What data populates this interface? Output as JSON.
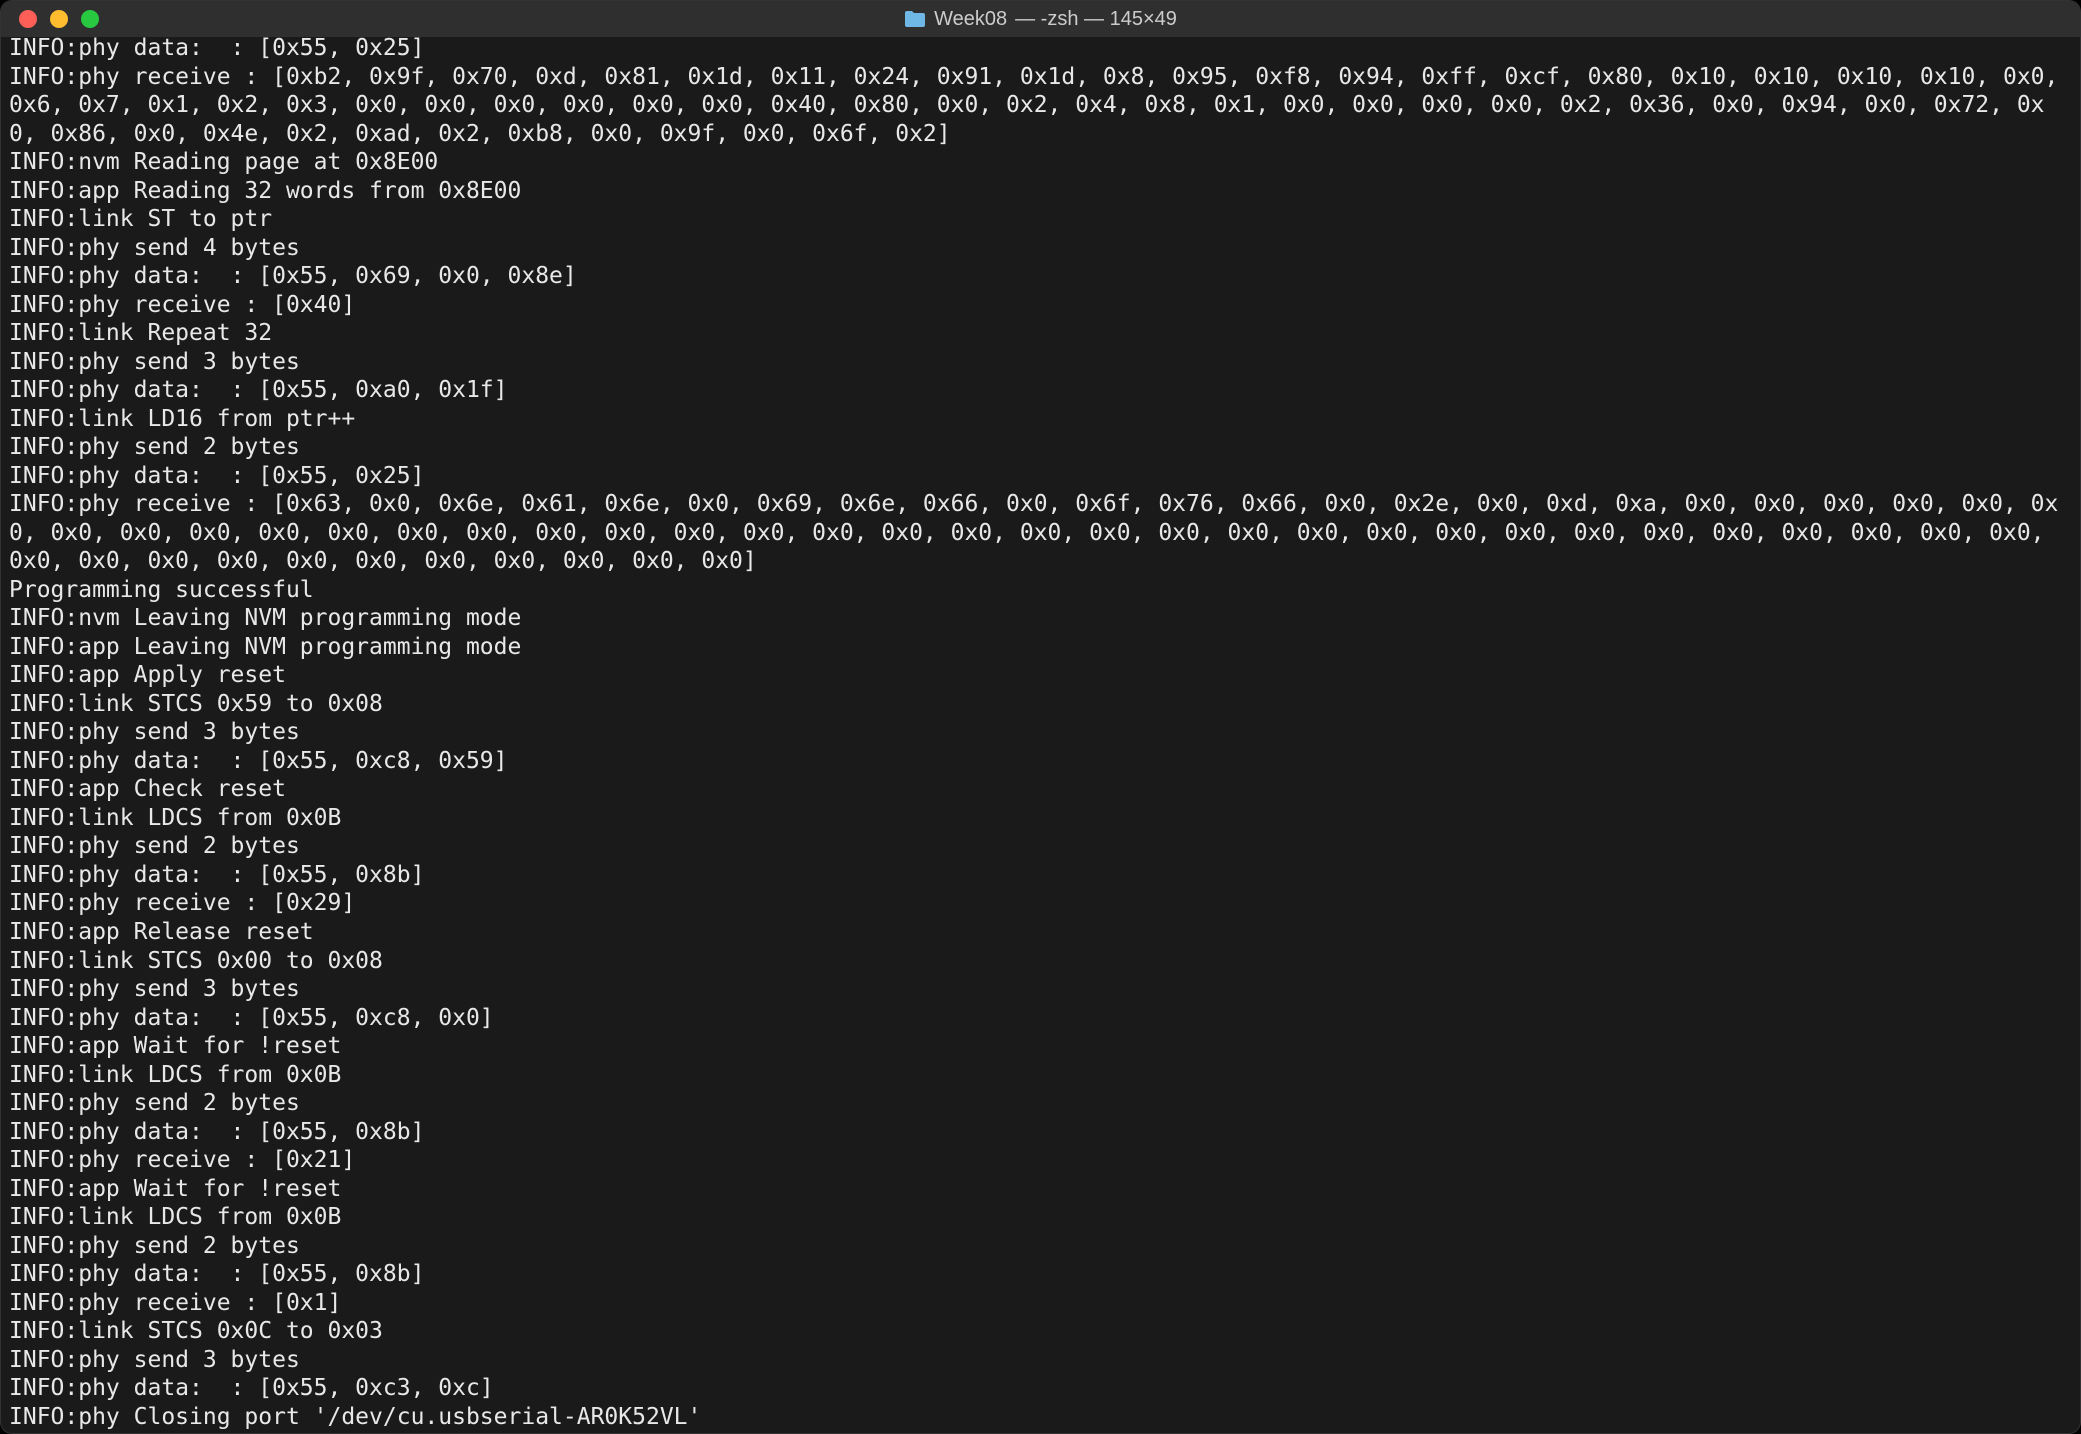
{
  "window": {
    "title_folder": "Week08",
    "title_rest": " — -zsh — 145×49"
  },
  "terminal": {
    "lines": [
      "INFO:phy data:  : [0x55, 0x25]",
      "INFO:phy receive : [0xb2, 0x9f, 0x70, 0xd, 0x81, 0x1d, 0x11, 0x24, 0x91, 0x1d, 0x8, 0x95, 0xf8, 0x94, 0xff, 0xcf, 0x80, 0x10, 0x10, 0x10, 0x10, 0x0, 0x6, 0x7, 0x1, 0x2, 0x3, 0x0, 0x0, 0x0, 0x0, 0x0, 0x0, 0x40, 0x80, 0x0, 0x2, 0x4, 0x8, 0x1, 0x0, 0x0, 0x0, 0x0, 0x2, 0x36, 0x0, 0x94, 0x0, 0x72, 0x0, 0x86, 0x0, 0x4e, 0x2, 0xad, 0x2, 0xb8, 0x0, 0x9f, 0x0, 0x6f, 0x2]",
      "INFO:nvm Reading page at 0x8E00",
      "INFO:app Reading 32 words from 0x8E00",
      "INFO:link ST to ptr",
      "INFO:phy send 4 bytes",
      "INFO:phy data:  : [0x55, 0x69, 0x0, 0x8e]",
      "INFO:phy receive : [0x40]",
      "INFO:link Repeat 32",
      "INFO:phy send 3 bytes",
      "INFO:phy data:  : [0x55, 0xa0, 0x1f]",
      "INFO:link LD16 from ptr++",
      "INFO:phy send 2 bytes",
      "INFO:phy data:  : [0x55, 0x25]",
      "INFO:phy receive : [0x63, 0x0, 0x6e, 0x61, 0x6e, 0x0, 0x69, 0x6e, 0x66, 0x0, 0x6f, 0x76, 0x66, 0x0, 0x2e, 0x0, 0xd, 0xa, 0x0, 0x0, 0x0, 0x0, 0x0, 0x0, 0x0, 0x0, 0x0, 0x0, 0x0, 0x0, 0x0, 0x0, 0x0, 0x0, 0x0, 0x0, 0x0, 0x0, 0x0, 0x0, 0x0, 0x0, 0x0, 0x0, 0x0, 0x0, 0x0, 0x0, 0x0, 0x0, 0x0, 0x0, 0x0, 0x0, 0x0, 0x0, 0x0, 0x0, 0x0, 0x0, 0x0, 0x0, 0x0, 0x0]",
      "Programming successful",
      "INFO:nvm Leaving NVM programming mode",
      "INFO:app Leaving NVM programming mode",
      "INFO:app Apply reset",
      "INFO:link STCS 0x59 to 0x08",
      "INFO:phy send 3 bytes",
      "INFO:phy data:  : [0x55, 0xc8, 0x59]",
      "INFO:app Check reset",
      "INFO:link LDCS from 0x0B",
      "INFO:phy send 2 bytes",
      "INFO:phy data:  : [0x55, 0x8b]",
      "INFO:phy receive : [0x29]",
      "INFO:app Release reset",
      "INFO:link STCS 0x00 to 0x08",
      "INFO:phy send 3 bytes",
      "INFO:phy data:  : [0x55, 0xc8, 0x0]",
      "INFO:app Wait for !reset",
      "INFO:link LDCS from 0x0B",
      "INFO:phy send 2 bytes",
      "INFO:phy data:  : [0x55, 0x8b]",
      "INFO:phy receive : [0x21]",
      "INFO:app Wait for !reset",
      "INFO:link LDCS from 0x0B",
      "INFO:phy send 2 bytes",
      "INFO:phy data:  : [0x55, 0x8b]",
      "INFO:phy receive : [0x1]",
      "INFO:link STCS 0x0C to 0x03",
      "INFO:phy send 3 bytes",
      "INFO:phy data:  : [0x55, 0xc3, 0xc]",
      "INFO:phy Closing port '/dev/cu.usbserial-AR0K52VL'"
    ]
  }
}
